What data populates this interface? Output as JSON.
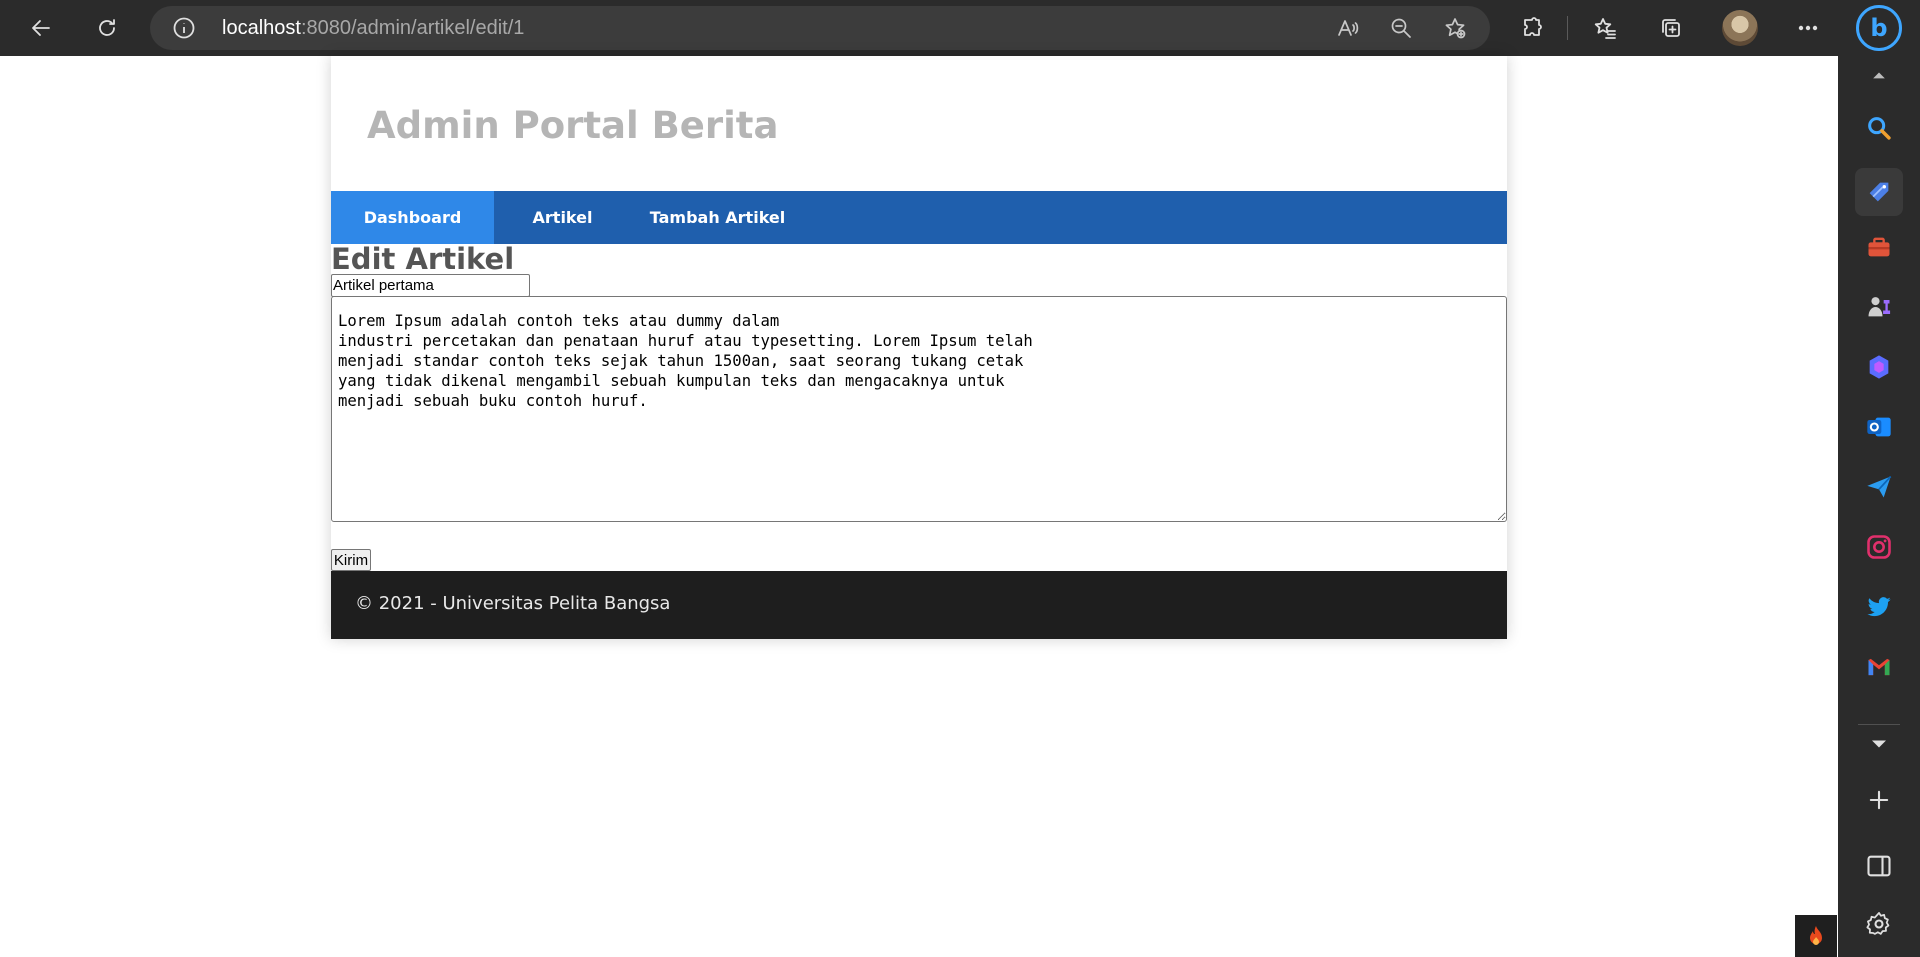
{
  "browser": {
    "url_host": "localhost",
    "url_path": ":8080/admin/artikel/edit/1",
    "bing_label": "b"
  },
  "site": {
    "title": "Admin Portal Berita",
    "nav": [
      {
        "label": "Dashboard",
        "active": true
      },
      {
        "label": "Artikel",
        "active": false
      },
      {
        "label": "Tambah Artikel",
        "active": false
      }
    ]
  },
  "form": {
    "heading": "Edit Artikel",
    "title_value": "Artikel pertama",
    "body_value": "Lorem Ipsum adalah contoh teks atau dummy dalam\nindustri percetakan dan penataan huruf atau typesetting. Lorem Ipsum telah\nmenjadi standar contoh teks sejak tahun 1500an, saat seorang tukang cetak\nyang tidak dikenal mengambil sebuah kumpulan teks dan mengacaknya untuk\nmenjadi sebuah buku contoh huruf.",
    "submit_label": "Kirim"
  },
  "footer": {
    "text": "© 2021 - Universitas Pelita Bangsa"
  },
  "sidebar_icons": [
    "search-icon",
    "tag-icon",
    "toolbox-icon",
    "games-icon",
    "copilot-icon",
    "outlook-icon",
    "send-icon",
    "instagram-icon",
    "twitter-icon",
    "gmail-icon",
    "chevron-down-icon",
    "add-icon",
    "split-screen-icon",
    "settings-icon"
  ],
  "colors": {
    "nav_bg": "#1f5fad",
    "nav_active": "#2f88e8",
    "footer_bg": "#1e1e1e",
    "title_gray": "#b5b5b5"
  }
}
